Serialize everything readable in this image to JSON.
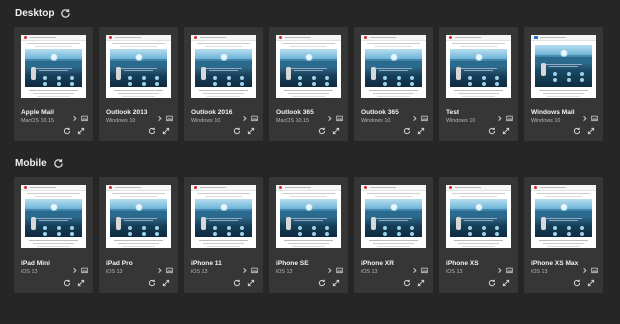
{
  "desktop": {
    "title": "Desktop",
    "cards": [
      {
        "name": "Apple Mail",
        "os": "MacOS 10.15"
      },
      {
        "name": "Outlook 2013",
        "os": "Windows 10"
      },
      {
        "name": "Outlook 2016",
        "os": "Windows 10"
      },
      {
        "name": "Outlook 365",
        "os": "MacOS 10.15"
      },
      {
        "name": "Outlook 365",
        "os": "Windows 10"
      },
      {
        "name": "Test",
        "os": "Windows 10"
      },
      {
        "name": "Windows Mail",
        "os": "Windows 10"
      }
    ]
  },
  "mobile": {
    "title": "Mobile",
    "cards": [
      {
        "name": "iPad Mini",
        "os": "iOS 13"
      },
      {
        "name": "iPad Pro",
        "os": "iOS 13"
      },
      {
        "name": "iPhone 11",
        "os": "iOS 13"
      },
      {
        "name": "iPhone SE",
        "os": "iOS 13"
      },
      {
        "name": "iPhone XR",
        "os": "iOS 13"
      },
      {
        "name": "iPhone XS",
        "os": "iOS 13"
      },
      {
        "name": "iPhone XS Max",
        "os": "iOS 13"
      }
    ]
  },
  "icons": {
    "section_refresh": "refresh-icon",
    "card_chevron": "chevron-right-icon",
    "card_preview": "image-icon",
    "card_refresh": "refresh-icon",
    "card_expand": "expand-icon"
  },
  "colors": {
    "background": "#262626",
    "card": "#363636",
    "text": "#f2f2f2",
    "subtext": "#b4b4b4"
  }
}
